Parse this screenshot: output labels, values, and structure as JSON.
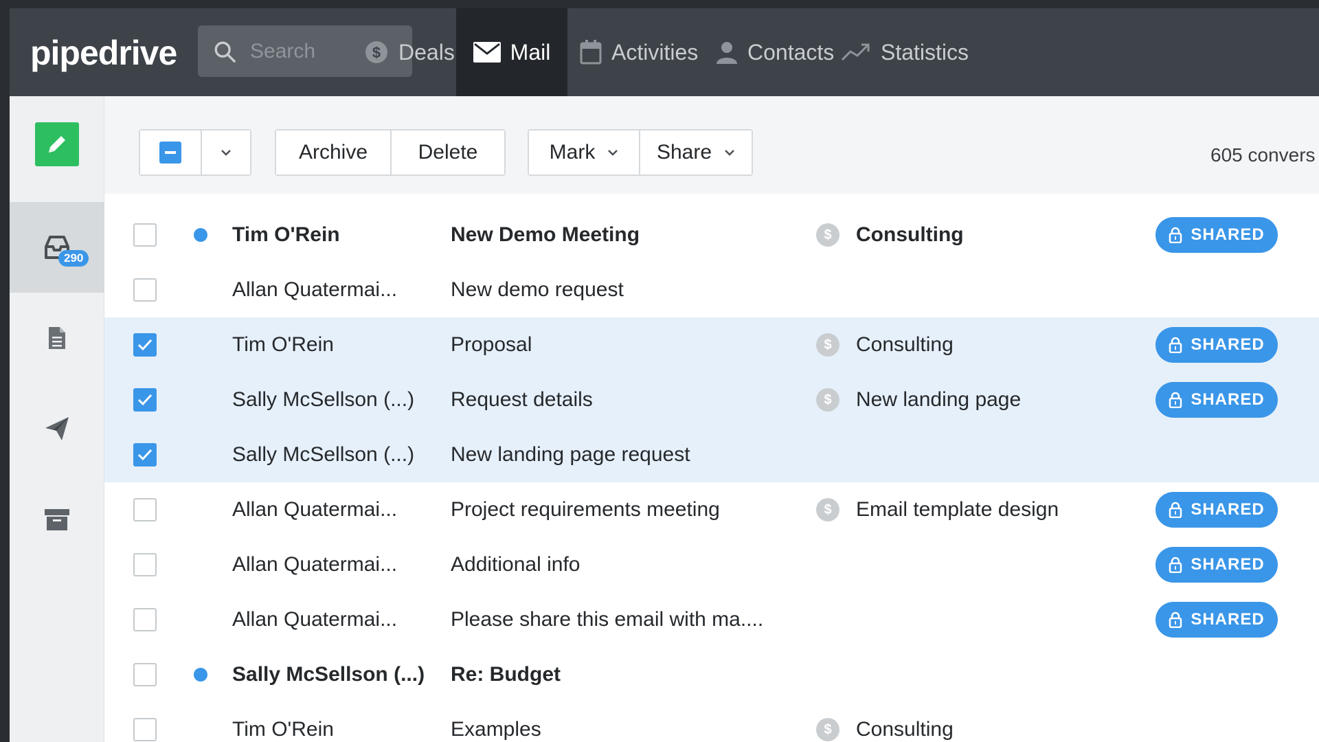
{
  "app": {
    "logo": "pipedrive"
  },
  "search": {
    "placeholder": "Search"
  },
  "nav": [
    {
      "label": "Deals",
      "icon": "dollar-icon",
      "active": false
    },
    {
      "label": "Mail",
      "icon": "envelope-icon",
      "active": true
    },
    {
      "label": "Activities",
      "icon": "calendar-icon",
      "active": false
    },
    {
      "label": "Contacts",
      "icon": "person-icon",
      "active": false
    },
    {
      "label": "Statistics",
      "icon": "trend-icon",
      "active": false
    }
  ],
  "sidebar": {
    "compose_icon": "pencil-icon",
    "inbox_count": "290",
    "items": [
      "inbox-icon",
      "document-icon",
      "paper-plane-icon",
      "archive-box-icon"
    ]
  },
  "toolbar": {
    "archive_label": "Archive",
    "delete_label": "Delete",
    "mark_label": "Mark",
    "share_label": "Share",
    "conversation_count": "605 convers"
  },
  "colors": {
    "accent": "#3a96e8",
    "compose": "#2dbe60",
    "topbar": "#3d4348",
    "selected_row": "#e6f0fa"
  },
  "rows": [
    {
      "sender": "Tim O'Rein",
      "subject": "New Demo Meeting",
      "deal": "Consulting",
      "shared": "SHARED",
      "unread": true,
      "checked": false
    },
    {
      "sender": "Allan Quatermai...",
      "subject": "New demo request",
      "deal": "",
      "shared": "",
      "unread": false,
      "checked": false
    },
    {
      "sender": "Tim O'Rein",
      "subject": "Proposal",
      "deal": "Consulting",
      "shared": "SHARED",
      "unread": false,
      "checked": true
    },
    {
      "sender": "Sally McSellson (...)",
      "subject": "Request details",
      "deal": "New landing page",
      "shared": "SHARED",
      "unread": false,
      "checked": true
    },
    {
      "sender": "Sally McSellson (...)",
      "subject": "New landing page request",
      "deal": "",
      "shared": "",
      "unread": false,
      "checked": true
    },
    {
      "sender": "Allan Quatermai...",
      "subject": "Project requirements meeting",
      "deal": "Email template design",
      "shared": "SHARED",
      "unread": false,
      "checked": false
    },
    {
      "sender": "Allan Quatermai...",
      "subject": "Additional info",
      "deal": "",
      "shared": "SHARED",
      "unread": false,
      "checked": false
    },
    {
      "sender": "Allan Quatermai...",
      "subject": "Please share this email with ma....",
      "deal": "",
      "shared": "SHARED",
      "unread": false,
      "checked": false
    },
    {
      "sender": "Sally McSellson (...)",
      "subject": "Re: Budget",
      "deal": "",
      "shared": "",
      "unread": true,
      "checked": false
    },
    {
      "sender": "Tim O'Rein",
      "subject": "Examples",
      "deal": "Consulting",
      "shared": "",
      "unread": false,
      "checked": false
    }
  ]
}
